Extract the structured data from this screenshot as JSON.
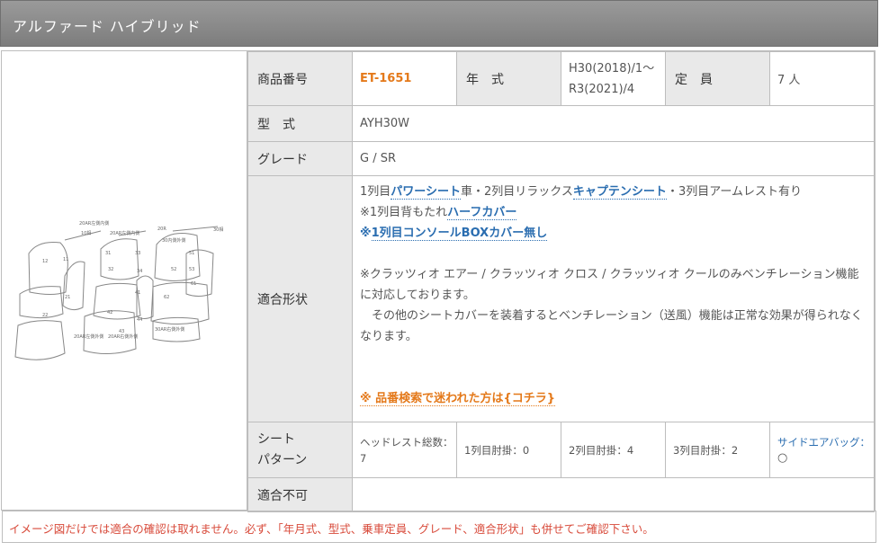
{
  "header": {
    "title": "アルファード ハイブリッド"
  },
  "diagram": {
    "labels": [
      "20AR左側内側",
      "10相",
      "20AR左側内側",
      "20R",
      "30相",
      "30内側外側",
      "12",
      "11",
      "31",
      "32",
      "33",
      "34",
      "51",
      "52",
      "53",
      "62",
      "61",
      "41",
      "22",
      "21",
      "42",
      "43",
      "44",
      "20AR左側外側",
      "20AR右側外側",
      "30AR右側外側"
    ]
  },
  "specs": {
    "product_no_label": "商品番号",
    "product_no": "ET-1651",
    "year_label": "年　式",
    "year_line1": "H30(2018)/1〜",
    "year_line2": "R3(2021)/4",
    "capacity_label": "定　員",
    "capacity": "7 人",
    "model_label": "型　式",
    "model": "AYH30W",
    "grade_label": "グレード",
    "grade": "G / SR",
    "fit_label": "適合形状",
    "fit": {
      "l1_a": "1列目",
      "l1_link1": "パワーシート",
      "l1_b": "車・2列目リラックス",
      "l1_link2": "キャプテンシート",
      "l1_c": "・3列目アームレスト有り",
      "l2_a": "※1列目背もたれ",
      "l2_link": "ハーフカバー",
      "l3_a": "※",
      "l3_link": "1列目コンソールBOXカバー無し",
      "p1": "※クラッツィオ エアー / クラッツィオ クロス / クラッツィオ クールのみベンチレーション機能に対応しております。",
      "p2": "　その他のシートカバーを装着するとベンチレーション（送風）機能は正常な効果が得られなくなります。",
      "search_link": "※ 品番検索で迷われた方は{コチラ}"
    },
    "seat_label": "シート\nパターン",
    "seat_label_1": "シート",
    "seat_label_2": "パターン",
    "seat": {
      "headrest_label": "ヘッドレスト総数：",
      "headrest_value": "7",
      "row1": "1列目肘掛：0",
      "row2": "2列目肘掛：4",
      "row3": "3列目肘掛：2",
      "airbag_label": "サイドエアバッグ：",
      "airbag_value": "○"
    },
    "incompatible_label": "適合不可",
    "incompatible": ""
  },
  "note": "イメージ図だけでは適合の確認は取れません。必ず、「年月式、型式、乗車定員、グレード、適合形状」も併せてご確認下さい。"
}
